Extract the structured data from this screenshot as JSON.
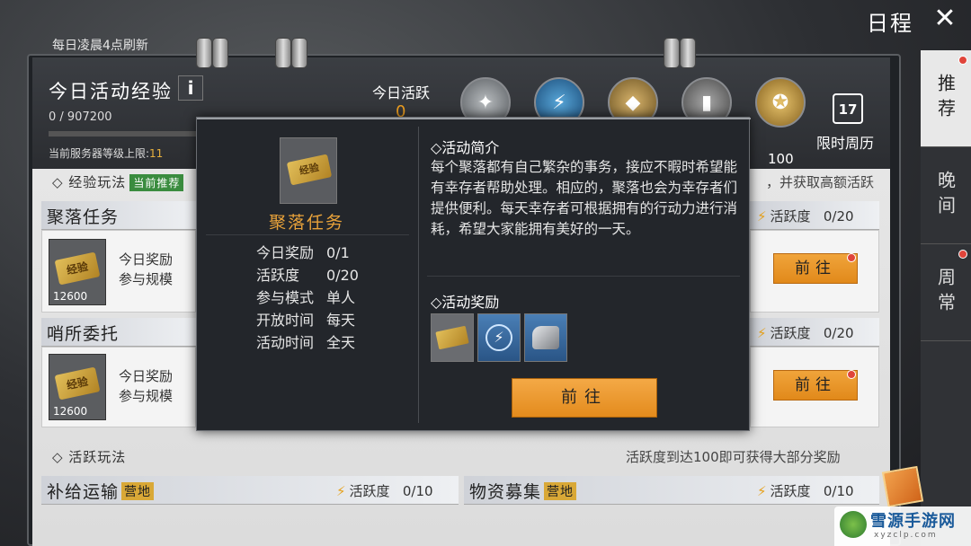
{
  "header": {
    "title": "日程",
    "refresh_note": "每日凌晨4点刷新"
  },
  "exp": {
    "title": "今日活动经验",
    "info": "i",
    "value": "0 / 907200",
    "server_cap_label": "当前服务器等级上限:",
    "server_cap_value": "11"
  },
  "activity": {
    "label": "今日活跃",
    "value": "0",
    "milestone_100": "100",
    "weekly_label": "限时周历",
    "weekly_day": "17"
  },
  "side_tabs": [
    {
      "label": "推荐"
    },
    {
      "label": "晚间"
    },
    {
      "label": "周常"
    }
  ],
  "sections": {
    "exp_play": "◇ 经验玩法",
    "exp_tag": "当前推荐",
    "exp_note": "，并获取高额活跃",
    "active_play": "◇ 活跃玩法",
    "active_note": "活跃度到达100即可获得大部分奖励"
  },
  "tasks": [
    {
      "name": "聚落任务",
      "stat_label": "活跃度",
      "stat": "0/20",
      "count": "12600",
      "info1": "今日奖励",
      "info2": "参与规模",
      "go": "前往",
      "ticket": "经验"
    },
    {
      "name": "哨所委托",
      "stat_label": "活跃度",
      "stat": "0/20",
      "count": "12600",
      "info1": "今日奖励",
      "info2": "参与规模",
      "go": "前往",
      "ticket": "经验"
    },
    {
      "name": "补给运输",
      "tag": "营地",
      "stat_label": "活跃度",
      "stat": "0/10"
    },
    {
      "name": "物资募集",
      "tag": "营地",
      "stat_label": "活跃度",
      "stat": "0/10"
    }
  ],
  "popup": {
    "name": "聚落任务",
    "ticket": "经验",
    "details": [
      {
        "k": "今日奖励",
        "v": "0/1"
      },
      {
        "k": "活跃度",
        "v": "0/20"
      },
      {
        "k": "参与模式",
        "v": "单人"
      },
      {
        "k": "开放时间",
        "v": "每天"
      },
      {
        "k": "活动时间",
        "v": "全天"
      }
    ],
    "intro_title": "◇活动简介",
    "intro": "每个聚落都有自己繁杂的事务，接应不暇时希望能有幸存者帮助处理。相应的，聚落也会为幸存者们提供便利。每天幸存者可根据拥有的行动力进行消耗，希望大家能拥有美好的一天。",
    "reward_title": "◇活动奖励",
    "go": "前往"
  },
  "watermark": {
    "text": "雪源手游网",
    "url": "xyzclp.com"
  },
  "colors": {
    "accent_orange": "#e38b1d",
    "active_yellow": "#f0a020",
    "tag_green": "#3a8c3f"
  }
}
